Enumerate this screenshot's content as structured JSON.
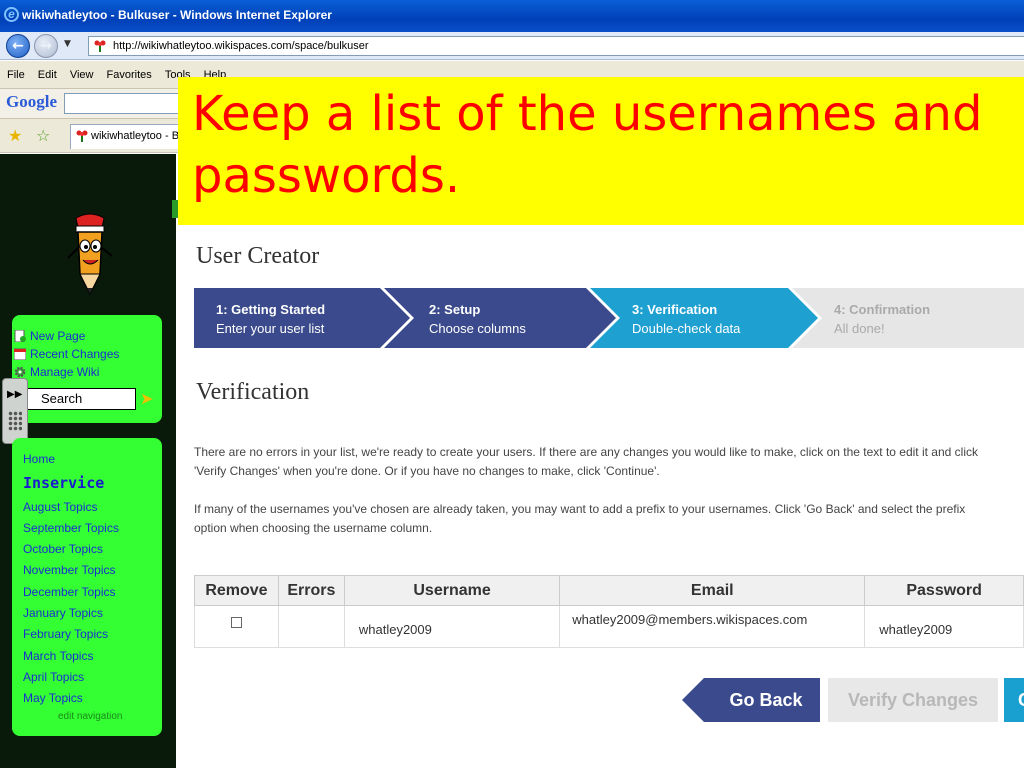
{
  "window": {
    "title": "wikiwhatleytoo - Bulkuser - Windows Internet Explorer"
  },
  "address_bar": {
    "url": "http://wikiwhatleytoo.wikispaces.com/space/bulkuser"
  },
  "menu": [
    "File",
    "Edit",
    "View",
    "Favorites",
    "Tools",
    "Help"
  ],
  "google_toolbar": {
    "logo": "Google"
  },
  "favorites_bar": {
    "tab_label": "wikiwhatleytoo - Bulkuser"
  },
  "callout": {
    "text_line1": "Keep a list of the usernames and",
    "text_line2": "passwords."
  },
  "sidebar": {
    "tools": [
      {
        "label": "New Page",
        "icon": "new-page-icon"
      },
      {
        "label": "Recent Changes",
        "icon": "calendar-icon"
      },
      {
        "label": "Manage Wiki",
        "icon": "gear-icon"
      }
    ],
    "search_value": "Search",
    "nav": [
      "Home",
      "Inservice",
      "August Topics",
      "September Topics",
      "October Topics",
      "November Topics",
      "December Topics",
      "January Topics",
      "February Topics",
      "March Topics",
      "April Topics",
      "May Topics"
    ],
    "edit_navigation": "edit navigation"
  },
  "main": {
    "title": "User Creator",
    "steps": [
      {
        "title": "1: Getting Started",
        "sub": "Enter your user list",
        "state": "done"
      },
      {
        "title": "2: Setup",
        "sub": "Choose columns",
        "state": "done"
      },
      {
        "title": "3: Verification",
        "sub": "Double-check data",
        "state": "active"
      },
      {
        "title": "4: Confirmation",
        "sub": "All done!",
        "state": "pending"
      }
    ],
    "section_title": "Verification",
    "para1_line1": "There are no errors in your list, we're ready to create your users. If there are any changes you would like to make, click on the text to edit it and click",
    "para1_line2": "'Verify Changes' when you're done. Or if you have no changes to make, click 'Continue'.",
    "para2_line1": "If many of the usernames you've chosen are already taken, you may want to add a prefix to your usernames. Click 'Go Back' and select the prefix",
    "para2_line2": "option when choosing the username column.",
    "table": {
      "headers": [
        "Remove",
        "Errors",
        "Username",
        "Email",
        "Password"
      ],
      "rows": [
        {
          "remove": false,
          "errors": "",
          "username": "whatley2009",
          "email": "whatley2009@members.wikispaces.com",
          "password": "whatley2009"
        }
      ]
    },
    "buttons": {
      "back": "Go Back",
      "verify": "Verify Changes",
      "continue": "Continue"
    }
  },
  "colors": {
    "step_done": "#3a4a8c",
    "step_active": "#1ea0d0",
    "step_pending": "#e6e6e6",
    "callout_bg": "#ffff00",
    "callout_text": "#ff0000",
    "sidebar_green": "#33ff33"
  }
}
